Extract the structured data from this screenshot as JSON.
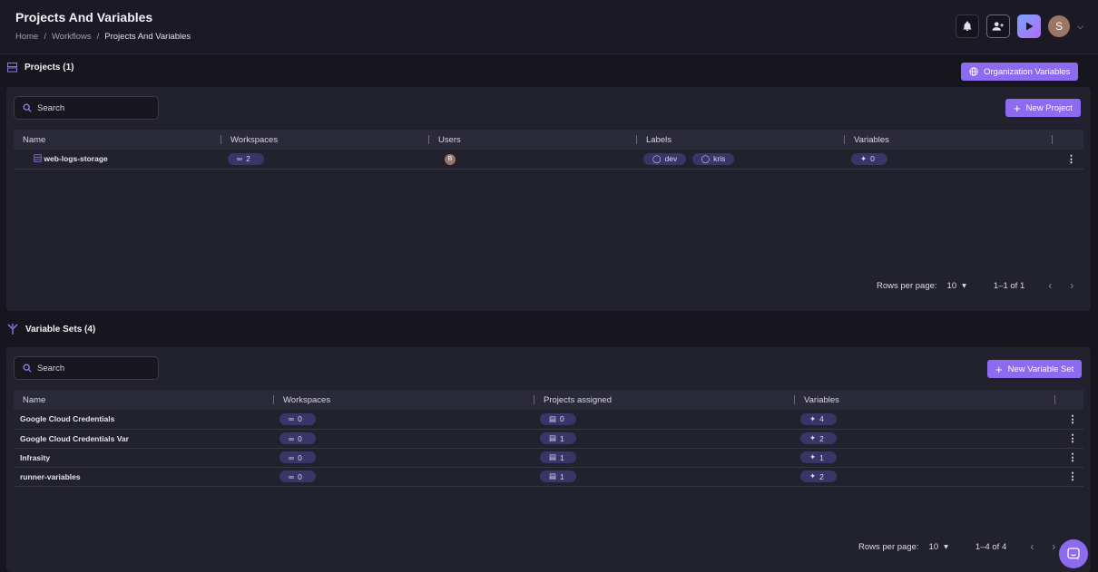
{
  "header": {
    "title": "Projects And Variables",
    "breadcrumb": [
      "Home",
      "Workflows",
      "Projects And Variables"
    ],
    "separator": "/",
    "avatar_initial": "S"
  },
  "projects": {
    "title": "Projects (1)",
    "org_vars_label": "Organization Variables",
    "search_placeholder": "Search",
    "new_label": "New Project",
    "columns": [
      "Name",
      "Workspaces",
      "Users",
      "Labels",
      "Variables"
    ],
    "rows": [
      {
        "name": "web-logs-storage",
        "workspaces": "2",
        "user_initial": "B",
        "labels": [
          "dev",
          "kris"
        ],
        "variables": "0"
      }
    ],
    "rows_per_page_label": "Rows per page:",
    "rows_per_page": "10",
    "range": "1–1 of 1"
  },
  "variable_sets": {
    "title": "Variable Sets (4)",
    "search_placeholder": "Search",
    "new_label": "New Variable Set",
    "columns": [
      "Name",
      "Workspaces",
      "Projects assigned",
      "Variables"
    ],
    "rows": [
      {
        "name": "Google Cloud Credentials",
        "workspaces": "0",
        "projects": "0",
        "variables": "4"
      },
      {
        "name": "Google Cloud Credentials Var",
        "workspaces": "0",
        "projects": "1",
        "variables": "2"
      },
      {
        "name": "Infrasity",
        "workspaces": "0",
        "projects": "1",
        "variables": "1"
      },
      {
        "name": "runner-variables",
        "workspaces": "0",
        "projects": "1",
        "variables": "2"
      }
    ],
    "rows_per_page_label": "Rows per page:",
    "rows_per_page": "10",
    "range": "1–4 of 4"
  },
  "colors": {
    "accent": "#8d6bf0",
    "chip": "#3a3566",
    "card": "#22212e",
    "background": "#17161f"
  }
}
